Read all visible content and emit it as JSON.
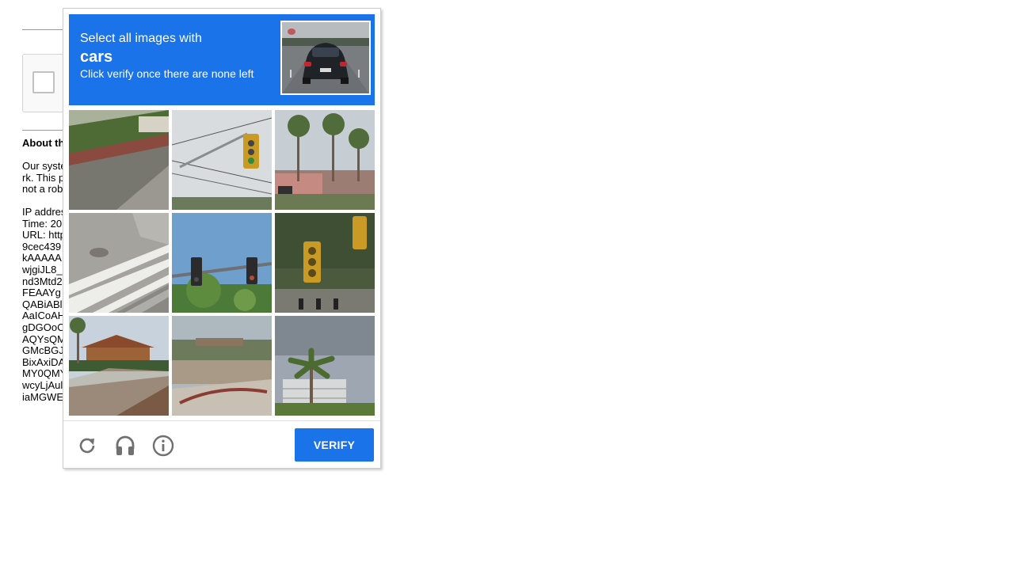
{
  "background_page": {
    "heading": "About th",
    "paragraph1": [
      "Our syste",
      "rk. This p",
      "not a rob"
    ],
    "details": [
      "IP addres",
      "Time: 20",
      "URL: http",
      "9cec439",
      "kAAAAA",
      "wjgiJL8_",
      "nd3Mtd2",
      "FEAAYg",
      "QABiABl",
      "AaICoAH",
      "gDGOoC",
      "AQYsQM",
      "GMcBGJ",
      "BixAxiDA",
      "MY0QMY",
      "wcyLjAul",
      "iaMGWE"
    ]
  },
  "captcha": {
    "prompt": "Select all images with",
    "target": "cars",
    "instruction": "Click verify once there are none left",
    "tiles": [
      {
        "name": "tile-1",
        "scene": "road-grass-sidewalk"
      },
      {
        "name": "tile-2",
        "scene": "traffic-light-pole"
      },
      {
        "name": "tile-3",
        "scene": "palm-trees-storefront"
      },
      {
        "name": "tile-4",
        "scene": "crosswalk"
      },
      {
        "name": "tile-5",
        "scene": "traffic-lights-arm"
      },
      {
        "name": "tile-6",
        "scene": "traffic-light-closeup"
      },
      {
        "name": "tile-7",
        "scene": "house-palm-road"
      },
      {
        "name": "tile-8",
        "scene": "hillside-buildings"
      },
      {
        "name": "tile-9",
        "scene": "palm-tree-building"
      }
    ],
    "footer": {
      "reload_icon": "reload-icon",
      "audio_icon": "headphones-icon",
      "info_icon": "info-icon",
      "verify_label": "VERIFY"
    },
    "colors": {
      "header_bg": "#1a73e8",
      "verify_bg": "#1a73e8",
      "icon_gray": "#707070"
    }
  }
}
